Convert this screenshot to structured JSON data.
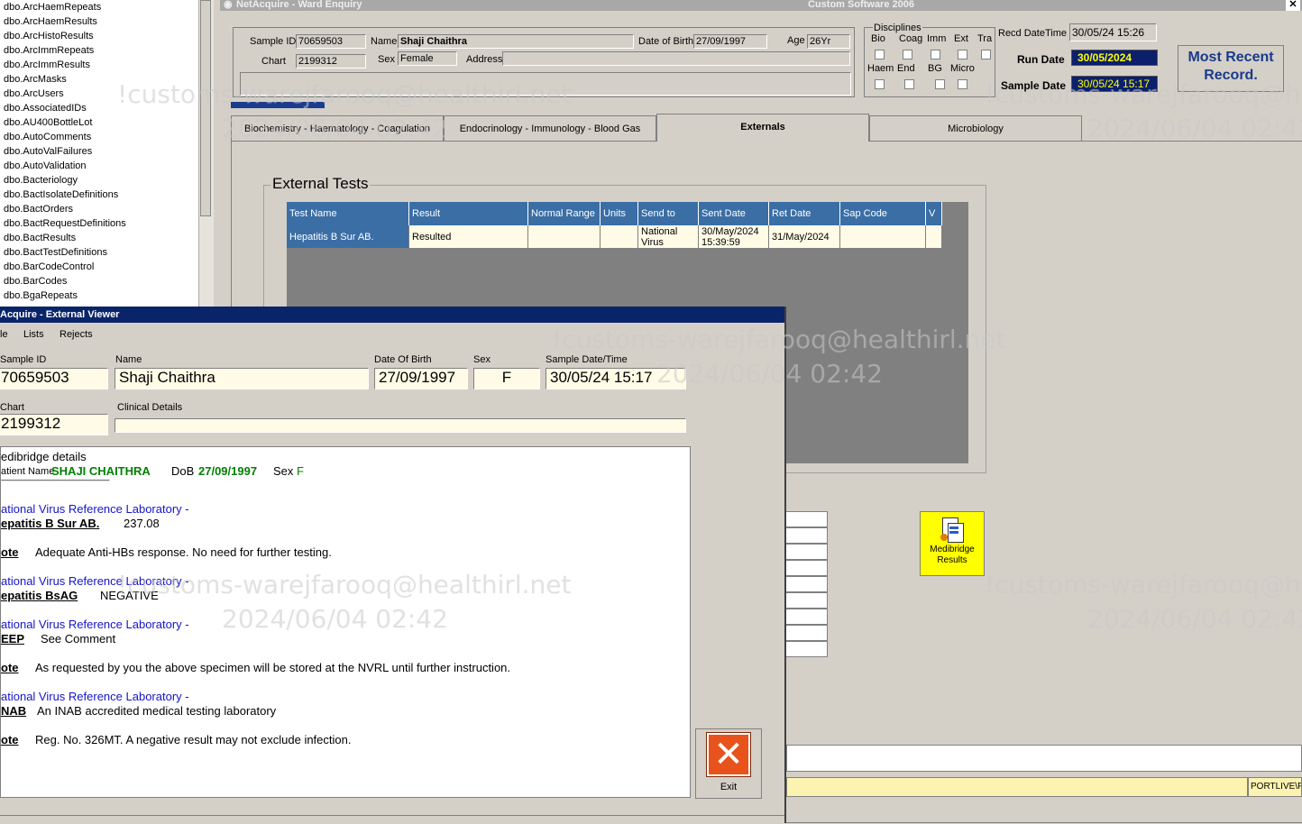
{
  "tree": {
    "items": [
      "dbo.ArcHaemRepeats",
      "dbo.ArcHaemResults",
      "dbo.ArcHistoResults",
      "dbo.ArcImmRepeats",
      "dbo.ArcImmResults",
      "dbo.ArcMasks",
      "dbo.ArcUsers",
      "dbo.AssociatedIDs",
      "dbo.AU400BottleLot",
      "dbo.AutoComments",
      "dbo.AutoValFailures",
      "dbo.AutoValidation",
      "dbo.Bacteriology",
      "dbo.BactIsolateDefinitions",
      "dbo.BactOrders",
      "dbo.BactRequestDefinitions",
      "dbo.BactResults",
      "dbo.BactTestDefinitions",
      "dbo.BarCodeControl",
      "dbo.BarCodes",
      "dbo.BgaRepeats"
    ]
  },
  "ward": {
    "title": "NetAcquire - Ward Enquiry",
    "subtitle": "Custom Software 2006",
    "close": "✕",
    "sample_id_label": "Sample ID",
    "sample_id": "70659503",
    "name_label": "Name",
    "name": "Shaji Chaithra",
    "dob_label": "Date of Birth",
    "dob": "27/09/1997",
    "age_label": "Age",
    "age": "26Yr",
    "chart_label": "Chart",
    "chart": "2199312",
    "sex_label": "Sex",
    "sex": "Female",
    "address_label": "Address",
    "address": "",
    "disciplines_label": "Disciplines",
    "disc_top": [
      "Bio",
      "Coag",
      "Imm",
      "Ext",
      "Tra"
    ],
    "disc_bottom": [
      "Haem",
      "End",
      "BG",
      "Micro"
    ],
    "recd_label": "Recd DateTime",
    "recd": "30/05/24 15:26",
    "run_date_label": "Run Date",
    "run_date": "30/05/2024",
    "sample_date_label": "Sample Date",
    "sample_date": "30/05/24 15:17",
    "most_recent": "Most Recent Record.",
    "tabs": [
      "Biochemistry - Haematology - Coagulation",
      "Endocrinology - Immunology - Blood Gas",
      "Externals",
      "Microbiology"
    ],
    "external_tests_title": "External Tests",
    "grid_headers": [
      "Test Name",
      "Result",
      "Normal Range",
      "Units",
      "Send to",
      "Sent Date",
      "Ret Date",
      "Sap Code",
      "V"
    ],
    "grid_row": [
      "Hepatitis B Sur AB.",
      "Resulted",
      "",
      "",
      "National Virus",
      "30/May/2024 15:39:59",
      "31/May/2024",
      "",
      ""
    ],
    "medibridge_label": "Medibridge Results",
    "status_right": "PORTLIVE\\P"
  },
  "watermark": {
    "line1": "!customs-warejfarooq@healthirl.net",
    "line2": "2024/06/04 02:42"
  },
  "viewer": {
    "title": "Acquire - External Viewer",
    "menu": [
      "le",
      "Lists",
      "Rejects"
    ],
    "sample_id_label": "Sample ID",
    "sample_id": "70659503",
    "name_label": "Name",
    "name": "Shaji Chaithra",
    "dob_label": "Date Of Birth",
    "dob": "27/09/1997",
    "sex_label": "Sex",
    "sex": "F",
    "sample_dt_label": "Sample Date/Time",
    "sample_dt": "30/05/24 15:17",
    "chart_label": "Chart",
    "chart": "2199312",
    "clinical_label": "Clinical Details",
    "clinical": "",
    "exit_label": "Exit",
    "report": {
      "header": "edibridge details",
      "patient_label": "atient Name",
      "patient_name": "SHAJI CHAITHRA",
      "dob_label": "DoB",
      "dob": "27/09/1997",
      "sex_label": "Sex",
      "sex": "F",
      "rule": "------------------------------------------------------------------------",
      "lab1": "ational Virus Reference Laboratory -",
      "t1": "epatitis B Sur AB.",
      "v1": "237.08",
      "n1_label": "ote",
      "n1": "Adequate Anti-HBs response.  No need for further testing.",
      "lab2": "ational Virus Reference Laboratory -",
      "t2": "epatitis BsAG",
      "v2": "NEGATIVE",
      "lab3": "ational Virus Reference Laboratory -",
      "t3": "EEP",
      "v3": "See Comment",
      "n3_label": "ote",
      "n3": "As requested by you the above specimen  will be stored at the NVRL until  further instruction.",
      "lab4": "ational Virus Reference Laboratory -",
      "t4": "NAB",
      "v4": "An INAB accredited medical testing laboratory",
      "n4_label": "ote",
      "n4": "Reg. No. 326MT.  A negative result may not exclude infection."
    }
  }
}
